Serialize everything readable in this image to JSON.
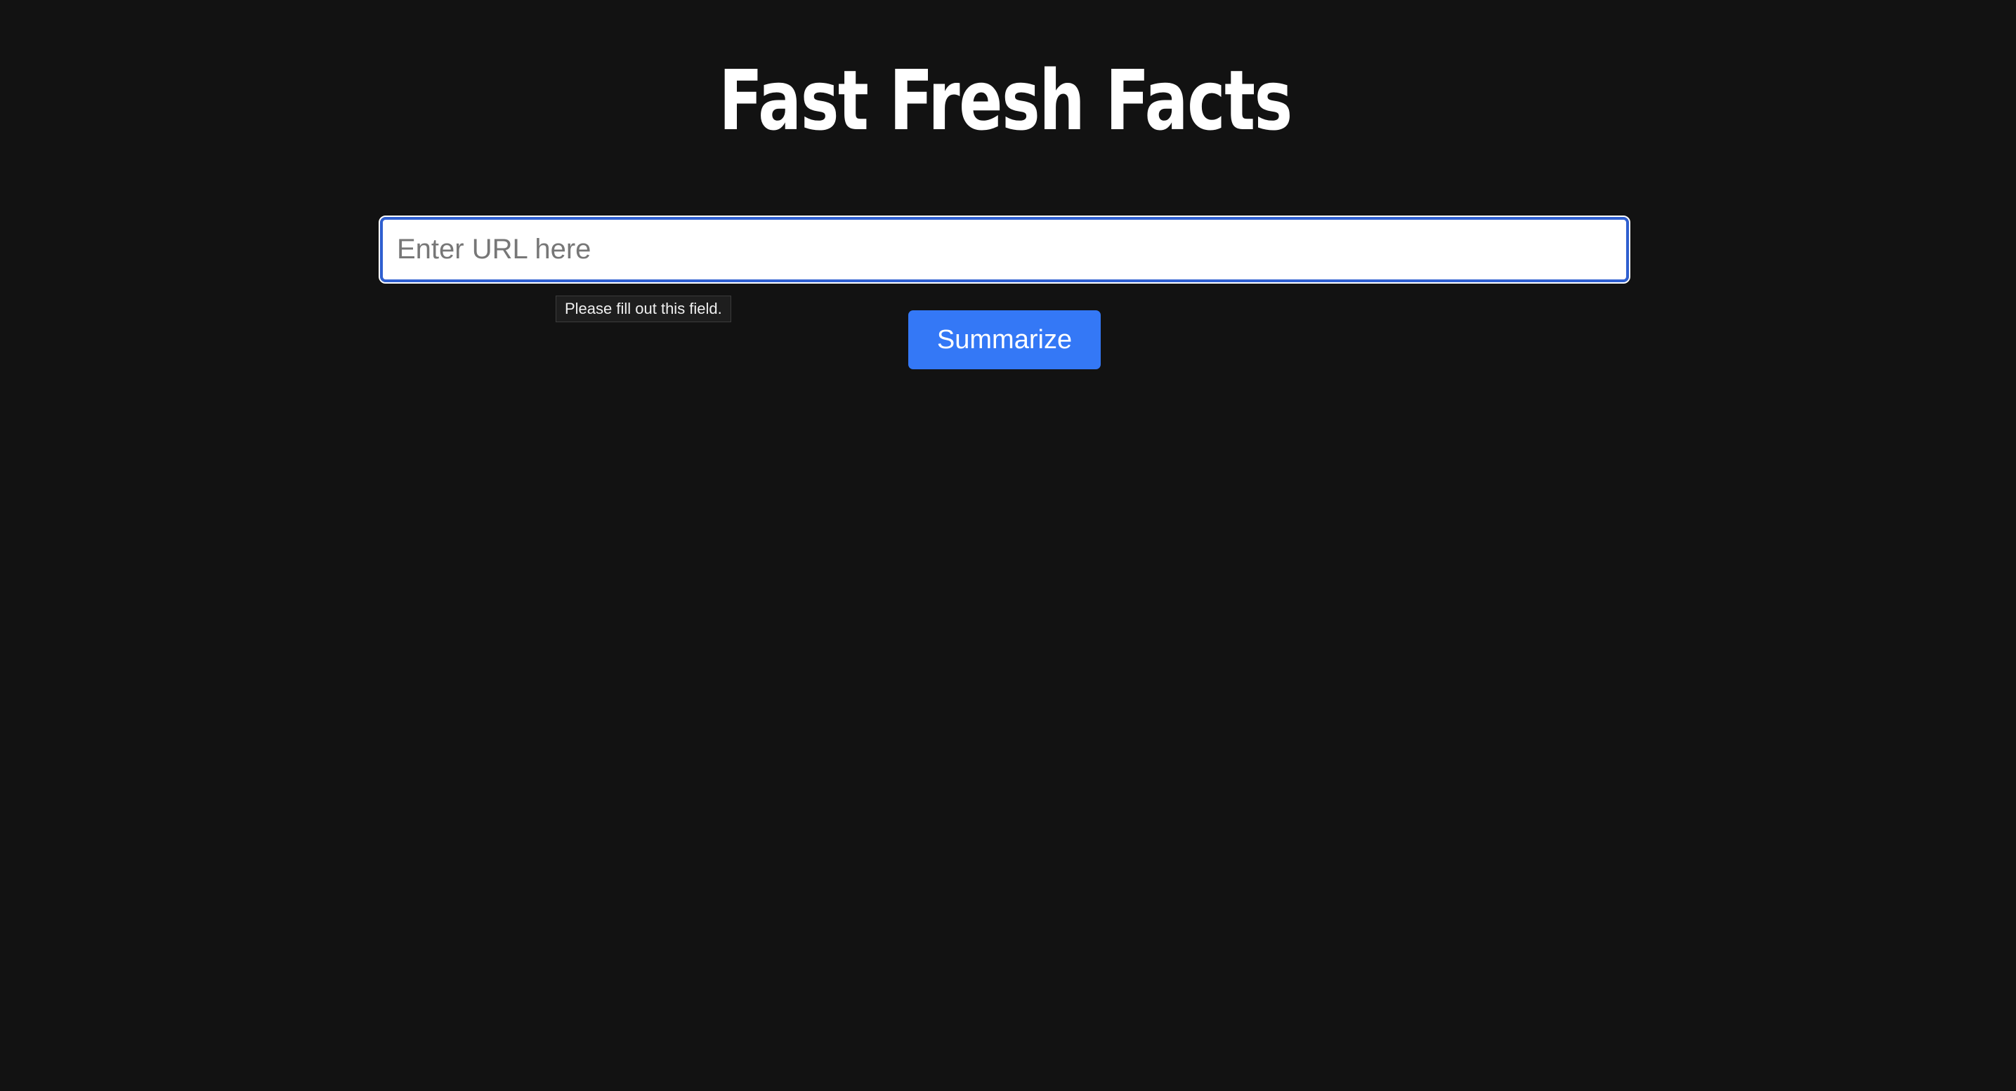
{
  "app": {
    "title": "Fast Fresh Facts"
  },
  "form": {
    "url_placeholder": "Enter URL here",
    "url_value": "",
    "validation_message": "Please fill out this field.",
    "submit_label": "Summarize"
  },
  "colors": {
    "background": "#121212",
    "title_text": "#ffffff",
    "button_background": "#3478f6",
    "button_text": "#ffffff",
    "input_focus_border": "#2f5fd0",
    "tooltip_background": "#1e1e1e"
  }
}
